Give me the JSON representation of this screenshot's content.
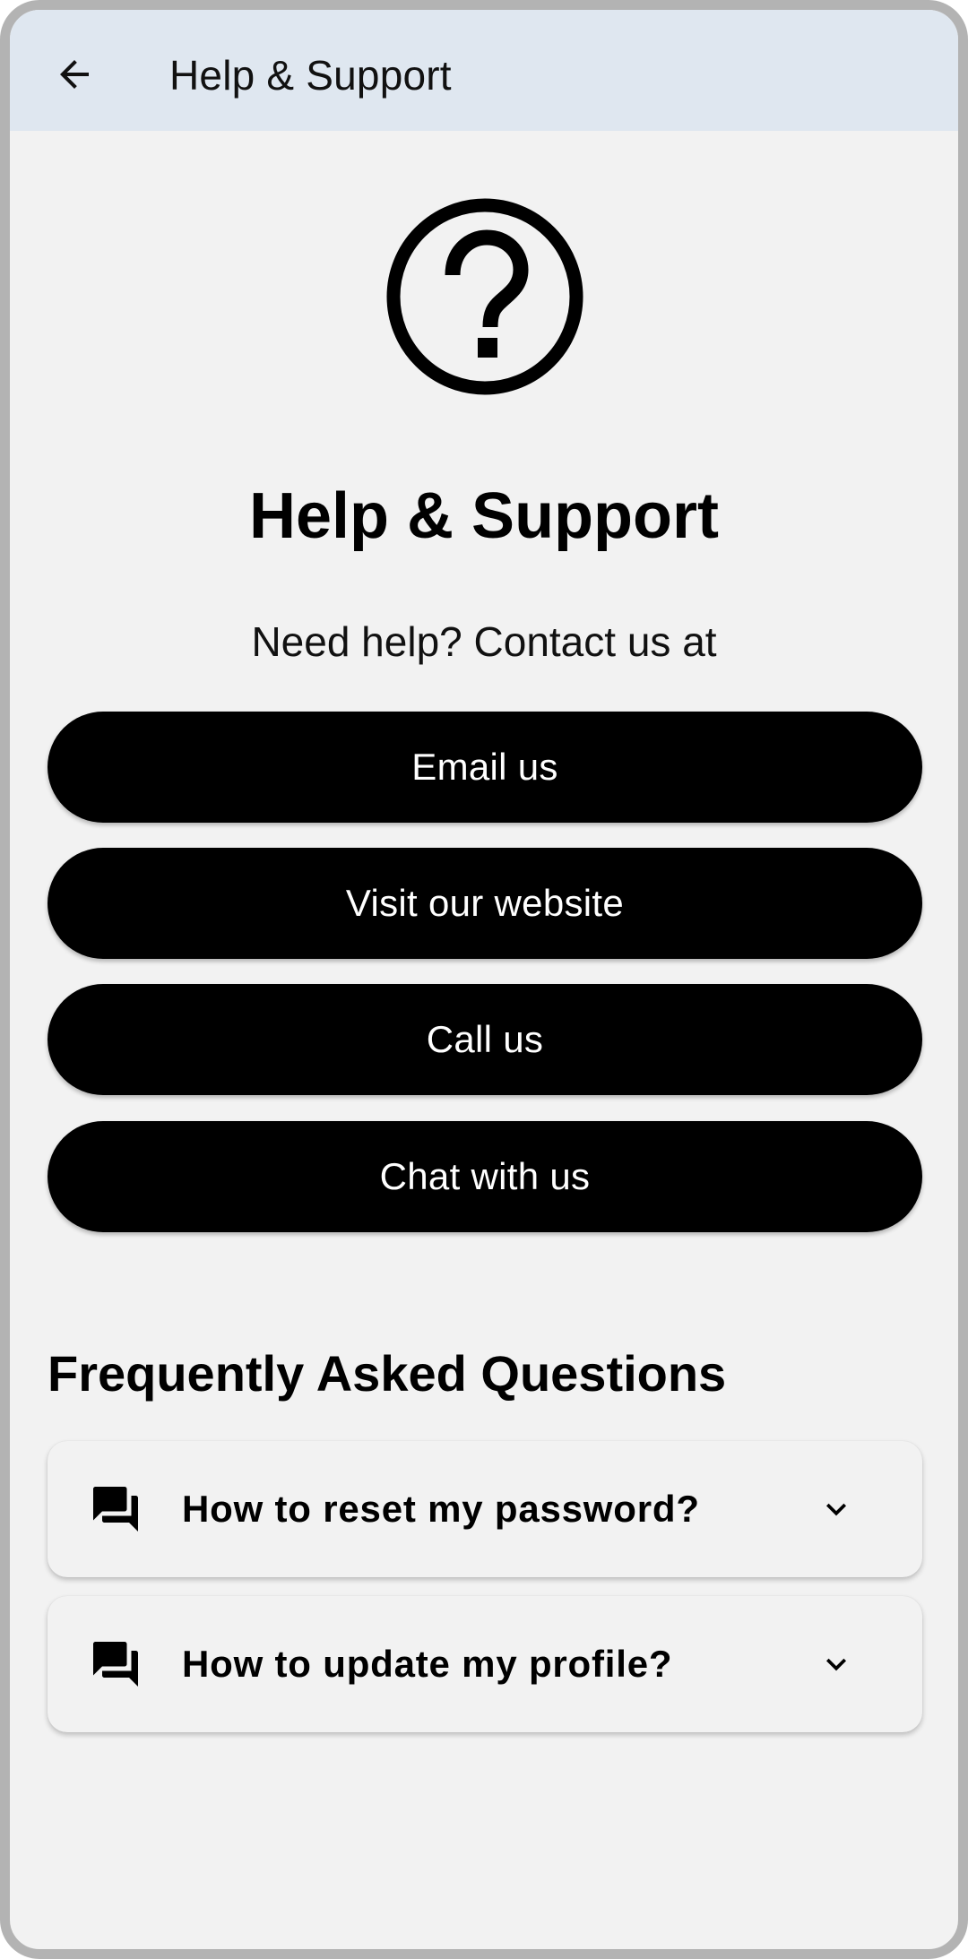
{
  "appbar": {
    "back_icon": "arrow-back-icon",
    "title": "Help & Support"
  },
  "hero": {
    "icon": "help-circle-icon",
    "title": "Help & Support",
    "subtitle": "Need help? Contact us at"
  },
  "contact": {
    "buttons": [
      {
        "label": "Email us"
      },
      {
        "label": "Visit our website"
      },
      {
        "label": "Call us"
      },
      {
        "label": "Chat with us"
      }
    ]
  },
  "faq": {
    "heading": "Frequently Asked Questions",
    "items": [
      {
        "icon": "forum-icon",
        "question": "How to reset my password?",
        "expanded": false
      },
      {
        "icon": "forum-icon",
        "question": "How to update my profile?",
        "expanded": false
      }
    ]
  },
  "colors": {
    "appbar_bg": "#dfe7f0",
    "page_bg": "#f2f2f2",
    "button_bg": "#000000",
    "button_text": "#ffffff",
    "frame": "#b3b3b3"
  }
}
